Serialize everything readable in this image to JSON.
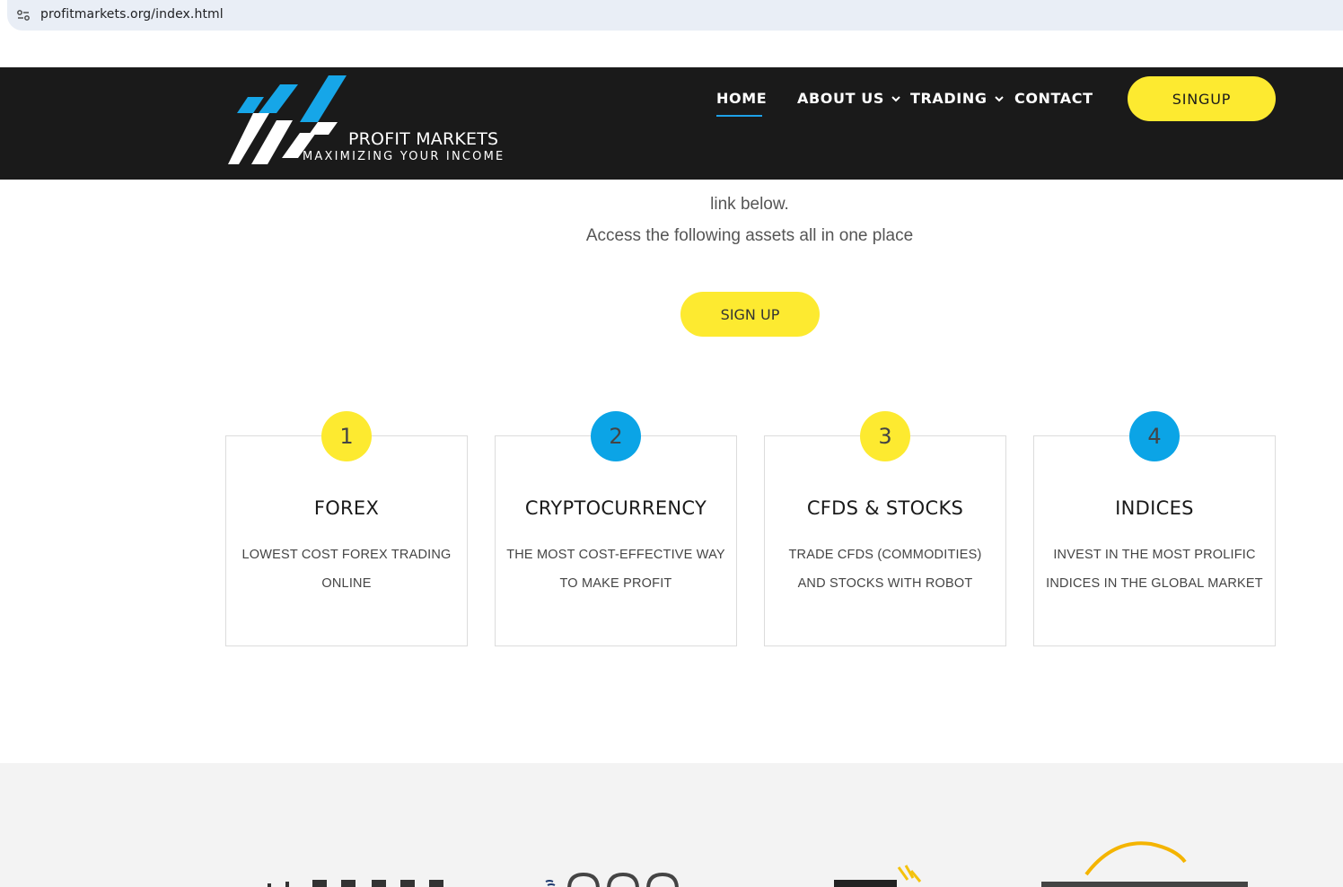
{
  "browser": {
    "url": "profitmarkets.org/index.html"
  },
  "header": {
    "logo_title": "PROFIT MARKETS",
    "logo_tagline": "MAXIMIZING YOUR INCOME",
    "nav": {
      "home": "HOME",
      "about": "ABOUT US",
      "trading": "TRADING",
      "contact": "CONTACT"
    },
    "signup_label": "SINGUP"
  },
  "intro": {
    "line2": "link below.",
    "line3": "Access the following assets all in one place",
    "signup_label": "SIGN UP"
  },
  "cards": [
    {
      "number": "1",
      "title": "FOREX",
      "desc": "LOWEST COST FOREX TRADING ONLINE"
    },
    {
      "number": "2",
      "title": "CRYPTOCURRENCY",
      "desc": "THE MOST COST-EFFECTIVE WAY TO MAKE PROFIT"
    },
    {
      "number": "3",
      "title": "CFDS & STOCKS",
      "desc": "TRADE CFDS (COMMODITIES) AND STOCKS WITH ROBOT"
    },
    {
      "number": "4",
      "title": "INDICES",
      "desc": "INVEST IN THE MOST PROLIFIC INDICES IN THE GLOBAL MARKET"
    }
  ],
  "colors": {
    "header_bg": "#1a1a1a",
    "accent_yellow": "#fdea30",
    "accent_blue": "#0ba4e6"
  },
  "icons": {
    "site_info": "site-settings-icon",
    "about_chevron": "chevron-down-icon",
    "trading_chevron": "chevron-down-icon"
  }
}
